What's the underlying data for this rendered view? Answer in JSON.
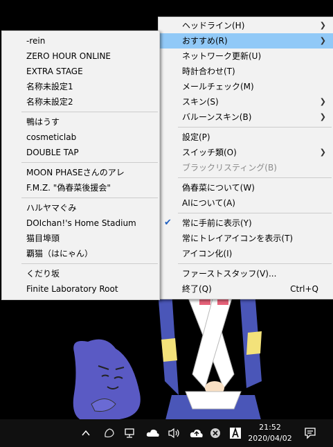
{
  "main_menu": {
    "items": [
      {
        "label": "ヘッドライン(H)",
        "submenu": true
      },
      {
        "label": "おすすめ(R)",
        "submenu": true,
        "highlighted": true
      },
      {
        "label": "ネットワーク更新(U)"
      },
      {
        "label": "時計合わせ(T)"
      },
      {
        "label": "メールチェック(M)"
      },
      {
        "label": "スキン(S)",
        "submenu": true
      },
      {
        "label": "バルーンスキン(B)",
        "submenu": true
      },
      {
        "label": "設定(P)"
      },
      {
        "label": "スイッチ類(O)",
        "submenu": true
      },
      {
        "label": "ブラックリスティング(B)",
        "disabled": true
      },
      {
        "label": "偽春菜について(W)"
      },
      {
        "label": "AIについて(A)"
      },
      {
        "label": "常に手前に表示(Y)",
        "checked": true
      },
      {
        "label": "常にトレイアイコンを表示(T)"
      },
      {
        "label": "アイコン化(I)"
      },
      {
        "label": "ファーストスタッフ(V)..."
      },
      {
        "label": "終了(Q)",
        "accel": "Ctrl+Q"
      }
    ]
  },
  "sub_menu": {
    "items": [
      {
        "label": "-rein"
      },
      {
        "label": "ZERO HOUR ONLINE"
      },
      {
        "label": "EXTRA STAGE"
      },
      {
        "label": "名称未設定1"
      },
      {
        "label": "名称未設定2"
      },
      {
        "label": "鴨はうす"
      },
      {
        "label": "cosmeticlab"
      },
      {
        "label": "DOUBLE TAP"
      },
      {
        "label": "MOON PHASEさんのアレ"
      },
      {
        "label": "F.M.Z. \"偽春菜後援会\""
      },
      {
        "label": "ハルヤマぐみ"
      },
      {
        "label": "DOIchan!'s Home Stadium"
      },
      {
        "label": "猫目埠頭"
      },
      {
        "label": "覇猫（はにゃん）"
      },
      {
        "label": "くだり坂"
      },
      {
        "label": "Finite Laboratory Root"
      }
    ]
  },
  "taskbar": {
    "time": "21:52",
    "date": "2020/04/02",
    "icons": [
      "chevron-up-icon",
      "bird-icon",
      "network-icon",
      "cloud-icon",
      "speaker-icon",
      "upload-cloud-icon",
      "close-circle-icon",
      "adobe-icon",
      "notification-icon"
    ]
  },
  "colors": {
    "highlight": "#91c9f7",
    "menu_bg": "#f2f2f2",
    "taskbar_bg": "#101010"
  }
}
